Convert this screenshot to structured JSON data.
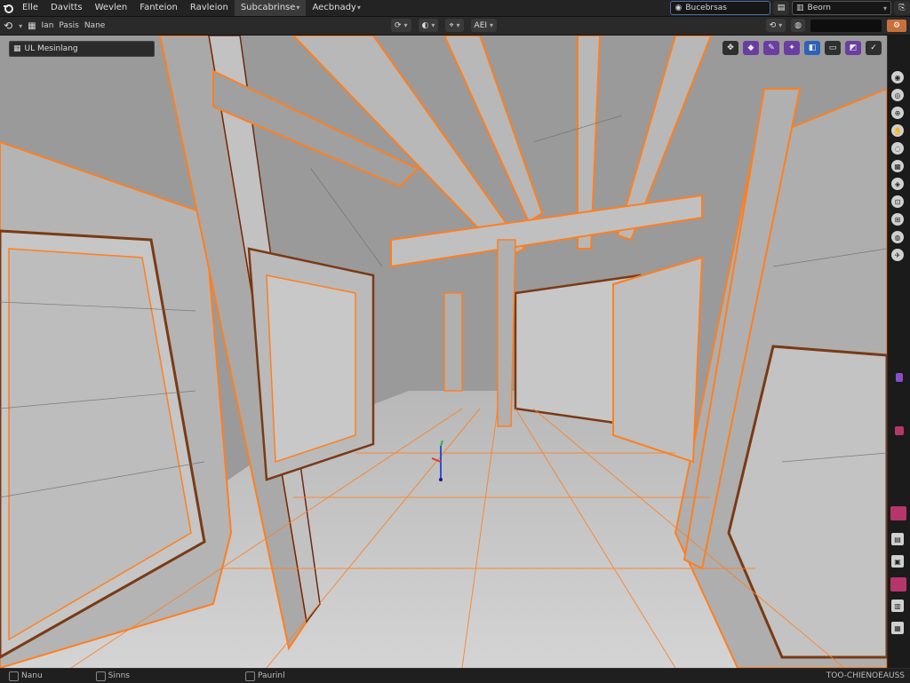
{
  "app": {
    "logo": "blender-logo-icon"
  },
  "menubar": {
    "items": [
      "Elle",
      "Davitts",
      "Wevlen",
      "Fanteion",
      "Ravleion",
      "Subcabrinse",
      "Aecbnady"
    ],
    "active_index": 5
  },
  "topright": {
    "scene_label": "Bucebrsas",
    "view_layer_label": "Beorn"
  },
  "header2": {
    "left_items": [
      "Ian",
      "Pasis",
      "Nane"
    ],
    "tool_label": "AEI"
  },
  "viewport": {
    "mode_label": "UL Mesinlang"
  },
  "status": {
    "left": "Nanu",
    "middle": "Sinns",
    "right_action": "Paurinl",
    "version": "TOO-CHIENOEAUSS"
  },
  "colors": {
    "edge_select": "#ff7f1f",
    "edge_dark": "#6a2a10",
    "face": "#c4c4c4",
    "face_shadow": "#a8a8a8",
    "purple_accent": "#8a4ec9",
    "blue_accent": "#2e62b8",
    "magenta_accent": "#b5366b"
  }
}
